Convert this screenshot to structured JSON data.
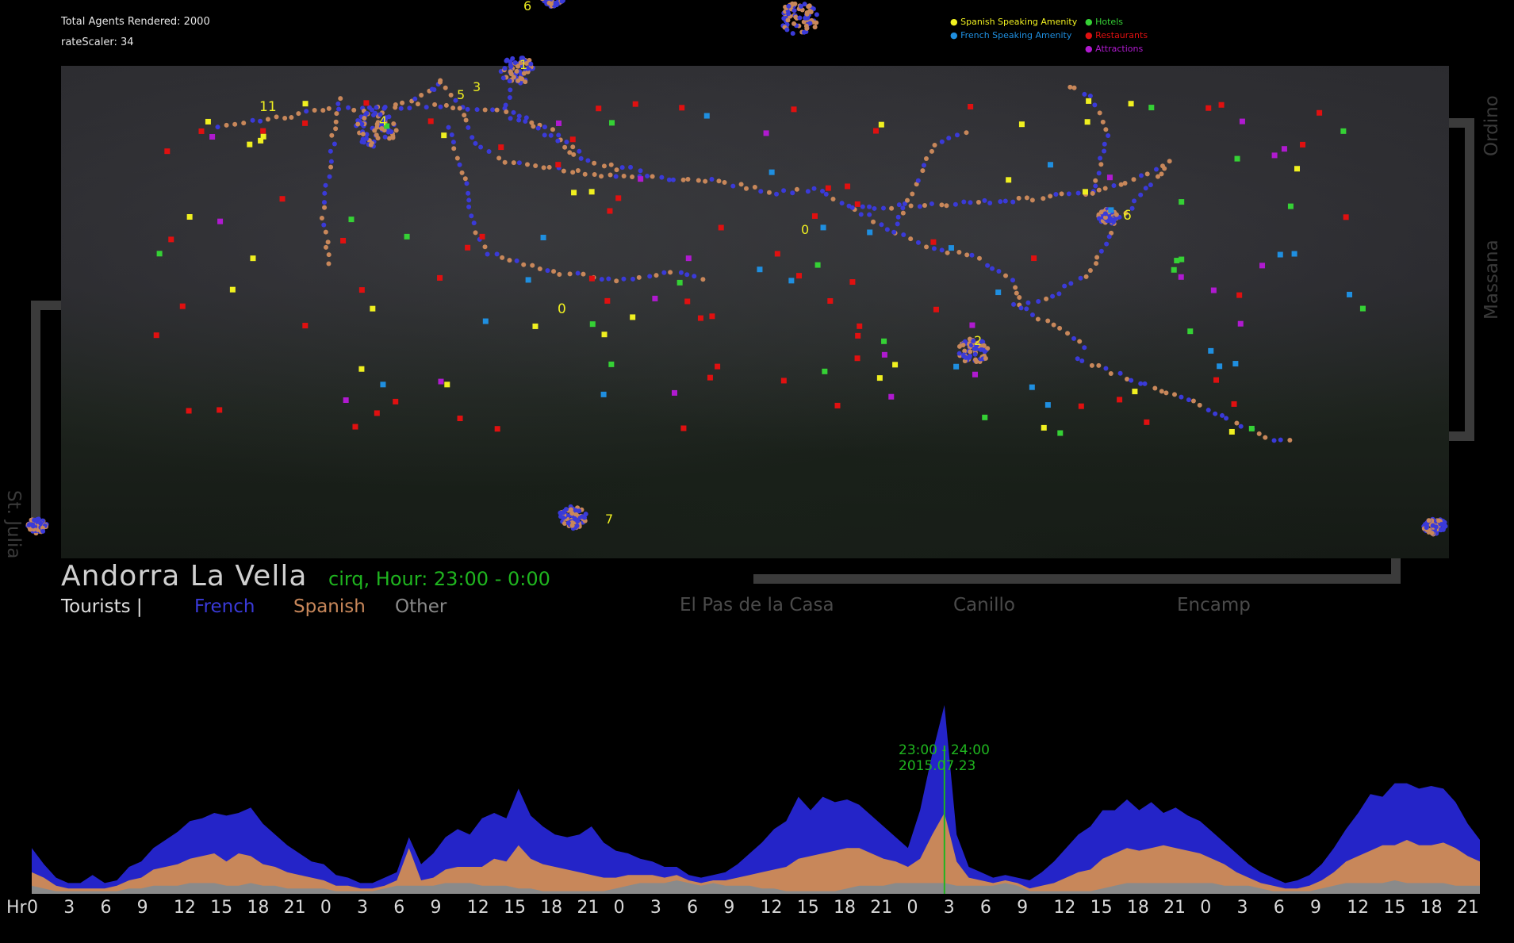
{
  "info": {
    "agents_rendered": "Total Agents Rendered: 2000",
    "rate_scaler": "rateScaler: 34"
  },
  "amenity_legend": {
    "spanish": "Spanish Speaking Amenity",
    "french": "French Speaking Amenity",
    "hotels": "Hotels",
    "restaurants": "Restaurants",
    "attractions": "Attractions"
  },
  "colors": {
    "french": "#3a3ad8",
    "spanish": "#c8875a",
    "other": "#8a8a8a",
    "hotel": "#35d135",
    "restaurant": "#e01010",
    "attraction": "#b01ad0",
    "spanish_amenity": "#f0f020",
    "french_amenity": "#1f8fe0",
    "green_text": "#1fb51f"
  },
  "map": {
    "city_name": "Andorra La Vella",
    "hour_label": "cirq, Hour: 23:00 - 0:00",
    "cluster_labels": [
      "11",
      "5",
      "3",
      "1",
      "4",
      "6",
      "0",
      "6",
      "2",
      "7",
      "0"
    ],
    "outer_towns": {
      "ordino": "Ordino",
      "massana": "Massana",
      "st_julia": "St. Julia",
      "el_pas": "El Pas de la Casa",
      "canillo": "Canillo",
      "encamp": "Encamp"
    }
  },
  "tourist_legend": {
    "label": "Tourists |",
    "french": "French",
    "spanish": "Spanish",
    "other": "Other"
  },
  "timeline": {
    "hr_label": "Hr",
    "marker_time": "23:00 - 24:00",
    "marker_date": "2015.07.23",
    "tick_labels": [
      "0",
      "3",
      "6",
      "9",
      "12",
      "15",
      "18",
      "21",
      "0",
      "3",
      "6",
      "9",
      "12",
      "15",
      "18",
      "21",
      "0",
      "3",
      "6",
      "9",
      "12",
      "15",
      "18",
      "21",
      "0",
      "3",
      "6",
      "9",
      "12",
      "15",
      "18",
      "21",
      "0",
      "3",
      "6",
      "9",
      "12",
      "15",
      "18",
      "21"
    ]
  },
  "chart_data": {
    "type": "area",
    "x_unit": "hour of day",
    "x_ticks": [
      "0",
      "3",
      "6",
      "9",
      "12",
      "15",
      "18",
      "21",
      "0",
      "3",
      "6",
      "9",
      "12",
      "15",
      "18",
      "21",
      "0",
      "3",
      "6",
      "9",
      "12",
      "15",
      "18",
      "21",
      "0",
      "3",
      "6",
      "9",
      "12",
      "15",
      "18",
      "21",
      "0",
      "3",
      "6",
      "9",
      "12",
      "15",
      "18",
      "21"
    ],
    "stacked": true,
    "series": [
      {
        "name": "Other",
        "values": [
          3,
          2,
          1,
          1,
          1,
          1,
          1,
          1,
          2,
          2,
          3,
          3,
          3,
          4,
          4,
          4,
          3,
          3,
          4,
          3,
          3,
          2,
          2,
          2,
          2,
          1,
          1,
          1,
          1,
          2,
          3,
          3,
          3,
          3,
          4,
          4,
          4,
          3,
          3,
          3,
          2,
          2,
          1,
          1,
          1,
          1,
          1,
          1,
          2,
          3,
          4,
          4,
          4,
          5,
          4,
          3,
          4,
          3,
          3,
          3,
          2,
          2,
          1,
          1,
          1,
          1,
          1,
          2,
          3,
          3,
          3,
          4,
          4,
          4,
          4,
          4,
          3,
          3,
          3,
          3,
          4,
          3,
          1,
          1,
          1,
          1,
          1,
          1,
          2,
          3,
          4,
          4,
          4,
          4,
          4,
          4,
          4,
          4,
          3,
          3,
          3,
          2,
          1,
          1,
          1,
          1,
          2,
          3,
          4,
          4,
          4,
          4,
          5,
          4,
          4,
          4,
          4,
          3,
          3,
          3
        ]
      },
      {
        "name": "Spanish",
        "values": [
          5,
          4,
          2,
          1,
          1,
          1,
          1,
          2,
          3,
          4,
          6,
          7,
          8,
          9,
          10,
          11,
          9,
          12,
          10,
          8,
          7,
          6,
          5,
          4,
          3,
          2,
          2,
          1,
          1,
          1,
          2,
          14,
          2,
          3,
          5,
          6,
          6,
          7,
          10,
          9,
          16,
          11,
          10,
          9,
          8,
          7,
          6,
          5,
          4,
          4,
          3,
          3,
          2,
          2,
          1,
          1,
          1,
          2,
          3,
          4,
          6,
          7,
          9,
          12,
          13,
          14,
          15,
          15,
          14,
          12,
          10,
          8,
          6,
          9,
          18,
          26,
          9,
          3,
          2,
          1,
          1,
          1,
          1,
          2,
          3,
          5,
          7,
          8,
          11,
          12,
          13,
          12,
          13,
          14,
          13,
          12,
          11,
          9,
          8,
          5,
          3,
          2,
          2,
          1,
          1,
          2,
          3,
          5,
          8,
          10,
          12,
          14,
          13,
          16,
          14,
          14,
          15,
          14,
          11,
          9
        ]
      },
      {
        "name": "French",
        "values": [
          9,
          5,
          3,
          2,
          2,
          5,
          2,
          2,
          5,
          6,
          8,
          10,
          12,
          14,
          14,
          15,
          17,
          15,
          18,
          15,
          12,
          10,
          8,
          6,
          6,
          4,
          3,
          2,
          2,
          3,
          3,
          4,
          6,
          9,
          12,
          14,
          12,
          18,
          17,
          16,
          21,
          16,
          14,
          12,
          12,
          14,
          18,
          13,
          10,
          8,
          6,
          5,
          4,
          3,
          2,
          2,
          2,
          3,
          5,
          8,
          11,
          15,
          17,
          23,
          17,
          21,
          18,
          18,
          16,
          14,
          12,
          9,
          7,
          18,
          30,
          40,
          10,
          4,
          3,
          2,
          2,
          2,
          3,
          5,
          8,
          11,
          14,
          16,
          18,
          16,
          18,
          15,
          17,
          12,
          15,
          13,
          12,
          10,
          8,
          7,
          5,
          4,
          3,
          2,
          3,
          4,
          6,
          9,
          12,
          16,
          21,
          18,
          23,
          21,
          21,
          22,
          20,
          17,
          12,
          8
        ]
      }
    ],
    "highlight": {
      "label": "23:00 - 24:00",
      "date": "2015.07.23"
    },
    "xlabel": "Hr"
  }
}
